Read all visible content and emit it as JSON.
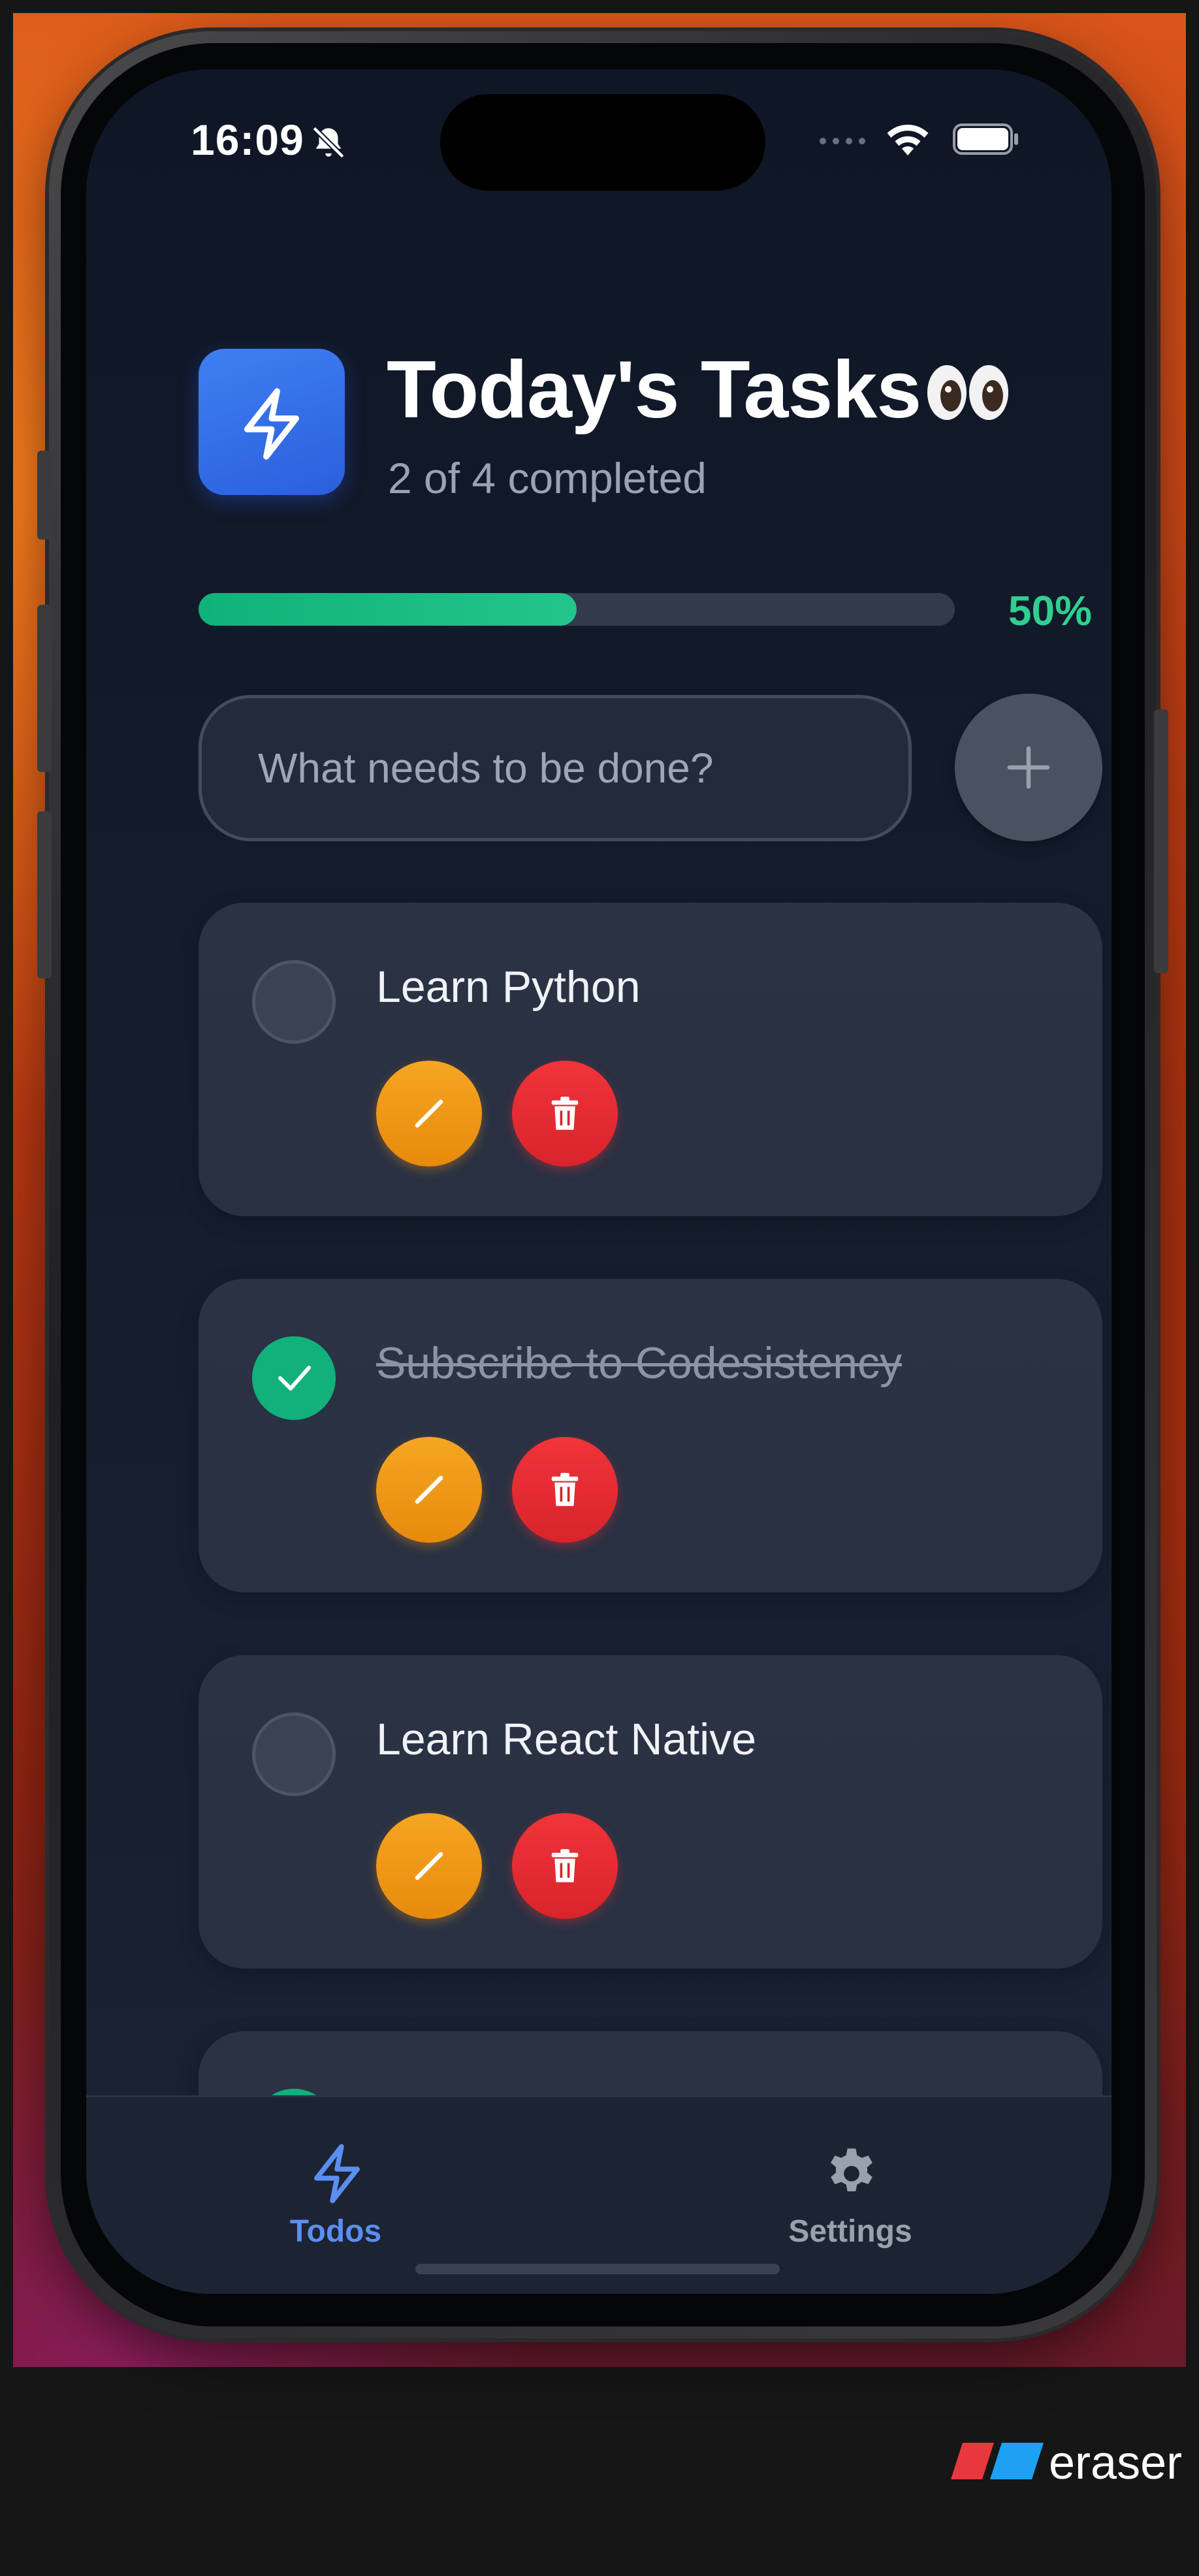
{
  "status_bar": {
    "time": "16:09",
    "silent": true
  },
  "app": {
    "title": "Today's Tasks",
    "emoji": "👀",
    "subtitle": "2 of 4 completed",
    "completed": 2,
    "total": 4,
    "progress_percent_label": "50%",
    "progress_fraction": 0.5
  },
  "input": {
    "placeholder": "What needs to be done?",
    "value": ""
  },
  "add_button": {
    "icon": "plus-icon"
  },
  "tasks": [
    {
      "label": "Learn Python",
      "completed": false
    },
    {
      "label": "Subscribe to Codesistency",
      "completed": true
    },
    {
      "label": "Learn React Native",
      "completed": false
    },
    {
      "label": "",
      "completed": true
    }
  ],
  "task_actions": {
    "edit_icon": "pencil-icon",
    "delete_icon": "trash-icon"
  },
  "tabs": [
    {
      "label": "Todos",
      "icon": "bolt-icon",
      "active": true
    },
    {
      "label": "Settings",
      "icon": "gear-icon",
      "active": false
    }
  ],
  "brand": {
    "name": "eraser"
  },
  "colors": {
    "accent_blue": "#5b8ef0",
    "success_green": "#12b07a",
    "edit_orange": "#f5a623",
    "delete_red": "#e8282e",
    "background": "#141c2c"
  }
}
